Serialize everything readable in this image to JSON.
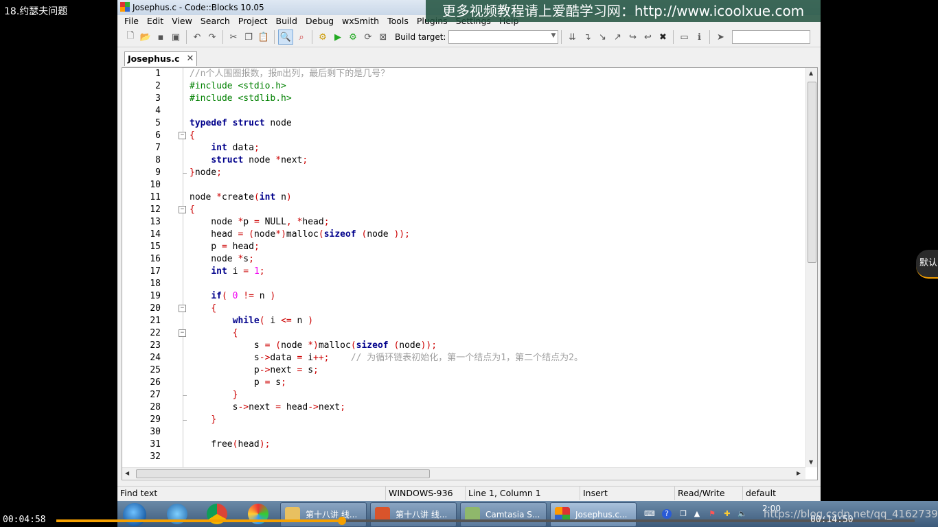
{
  "player": {
    "video_title": "18.约瑟夫问题",
    "time_elapsed": "00:04:58",
    "time_total": "00:14:50",
    "progress_fraction": 0.333,
    "side_badge": "默认",
    "watermark": "更多视频教程请上爱酷学习网：http://www.icoolxue.com",
    "csdn_watermark": "https://blog.csdn.net/qq_41627390"
  },
  "window": {
    "title": "Josephus.c - Code::Blocks 10.05"
  },
  "menu": [
    "File",
    "Edit",
    "View",
    "Search",
    "Project",
    "Build",
    "Debug",
    "wxSmith",
    "Tools",
    "Plugins",
    "Settings",
    "Help"
  ],
  "toolbar": {
    "build_target_label": "Build target:",
    "build_target_value": ""
  },
  "tabs": [
    {
      "label": "Josephus.c",
      "active": true
    }
  ],
  "code_lines": [
    {
      "n": "1",
      "fold": "",
      "html": "<span class=\"cm\">//n个人围圈报数，报m出列，最后剩下的是几号？</span>"
    },
    {
      "n": "2",
      "fold": "",
      "html": "<span class=\"pp\">#include &lt;stdio.h&gt;</span>"
    },
    {
      "n": "3",
      "fold": "",
      "html": "<span class=\"pp\">#include &lt;stdlib.h&gt;</span>"
    },
    {
      "n": "4",
      "fold": "",
      "html": ""
    },
    {
      "n": "5",
      "fold": "",
      "html": "<span class=\"kw\">typedef</span> <span class=\"kw\">struct</span> node"
    },
    {
      "n": "6",
      "fold": "minus",
      "html": "<span class=\"op\">{</span>"
    },
    {
      "n": "7",
      "fold": "",
      "html": "    <span class=\"kw\">int</span> data<span class=\"op\">;</span>"
    },
    {
      "n": "8",
      "fold": "",
      "html": "    <span class=\"kw\">struct</span> node <span class=\"op\">*</span>next<span class=\"op\">;</span>"
    },
    {
      "n": "9",
      "fold": "end",
      "html": "<span class=\"op\">}</span>node<span class=\"op\">;</span>"
    },
    {
      "n": "10",
      "fold": "",
      "html": ""
    },
    {
      "n": "11",
      "fold": "",
      "html": "node <span class=\"op\">*</span>create<span class=\"op\">(</span><span class=\"kw\">int</span> n<span class=\"op\">)</span>"
    },
    {
      "n": "12",
      "fold": "minus",
      "html": "<span class=\"op\">{</span>"
    },
    {
      "n": "13",
      "fold": "",
      "html": "    node <span class=\"op\">*</span>p <span class=\"op\">=</span> NULL<span class=\"op\">,</span> <span class=\"op\">*</span>head<span class=\"op\">;</span>"
    },
    {
      "n": "14",
      "fold": "",
      "html": "    head <span class=\"op\">=</span> <span class=\"op\">(</span>node<span class=\"op\">*)</span>malloc<span class=\"op\">(</span><span class=\"kw\">sizeof</span> <span class=\"op\">(</span>node <span class=\"op\">));</span>"
    },
    {
      "n": "15",
      "fold": "",
      "html": "    p <span class=\"op\">=</span> head<span class=\"op\">;</span>"
    },
    {
      "n": "16",
      "fold": "",
      "html": "    node <span class=\"op\">*</span>s<span class=\"op\">;</span>"
    },
    {
      "n": "17",
      "fold": "",
      "html": "    <span class=\"kw\">int</span> i <span class=\"op\">=</span> <span class=\"num\">1</span><span class=\"op\">;</span>"
    },
    {
      "n": "18",
      "fold": "",
      "html": ""
    },
    {
      "n": "19",
      "fold": "",
      "html": "    <span class=\"kw\">if</span><span class=\"op\">(</span> <span class=\"num\">0</span> <span class=\"op\">!=</span> n <span class=\"op\">)</span>"
    },
    {
      "n": "20",
      "fold": "minus",
      "html": "    <span class=\"op\">{</span>"
    },
    {
      "n": "21",
      "fold": "",
      "html": "        <span class=\"kw\">while</span><span class=\"op\">(</span> i <span class=\"op\">&lt;=</span> n <span class=\"op\">)</span>"
    },
    {
      "n": "22",
      "fold": "minus",
      "html": "        <span class=\"op\">{</span>"
    },
    {
      "n": "23",
      "fold": "",
      "html": "            s <span class=\"op\">=</span> <span class=\"op\">(</span>node <span class=\"op\">*)</span>malloc<span class=\"op\">(</span><span class=\"kw\">sizeof</span> <span class=\"op\">(</span>node<span class=\"op\">));</span>"
    },
    {
      "n": "24",
      "fold": "",
      "html": "            s<span class=\"op\">-&gt;</span>data <span class=\"op\">=</span> i<span class=\"op\">++;</span>    <span class=\"cm\">// 为循环链表初始化，第一个结点为1，第二个结点为2。</span>"
    },
    {
      "n": "25",
      "fold": "",
      "html": "            p<span class=\"op\">-&gt;</span>next <span class=\"op\">=</span> s<span class=\"op\">;</span>"
    },
    {
      "n": "26",
      "fold": "",
      "html": "            p <span class=\"op\">=</span> s<span class=\"op\">;</span>"
    },
    {
      "n": "27",
      "fold": "end",
      "html": "        <span class=\"op\">}</span>"
    },
    {
      "n": "28",
      "fold": "",
      "html": "        s<span class=\"op\">-&gt;</span>next <span class=\"op\">=</span> head<span class=\"op\">-&gt;</span>next<span class=\"op\">;</span>"
    },
    {
      "n": "29",
      "fold": "end",
      "html": "    <span class=\"op\">}</span>"
    },
    {
      "n": "30",
      "fold": "",
      "html": ""
    },
    {
      "n": "31",
      "fold": "",
      "html": "    free<span class=\"op\">(</span>head<span class=\"op\">);</span>"
    },
    {
      "n": "32",
      "fold": "",
      "html": ""
    }
  ],
  "status": {
    "left": "Find text",
    "encoding": "WINDOWS-936",
    "position": "Line 1, Column 1",
    "mode": "Insert",
    "access": "Read/Write",
    "theme": "default"
  },
  "taskbar": {
    "buttons": [
      {
        "label": "第十八讲 线...",
        "color": "#e8c060"
      },
      {
        "label": "第十八讲 线...",
        "color": "#d9542b"
      },
      {
        "label": "Camtasia S...",
        "color": "#8fb86b"
      },
      {
        "label": "Josephus.c...",
        "color": "#c0392b"
      }
    ],
    "clock": "2:00"
  },
  "colors": {
    "keyword": "#00008b",
    "preprocessor": "#008000",
    "comment": "#a0a0a0",
    "operator": "#cc0000",
    "number": "#f000f0",
    "progress": "#f5a000"
  }
}
